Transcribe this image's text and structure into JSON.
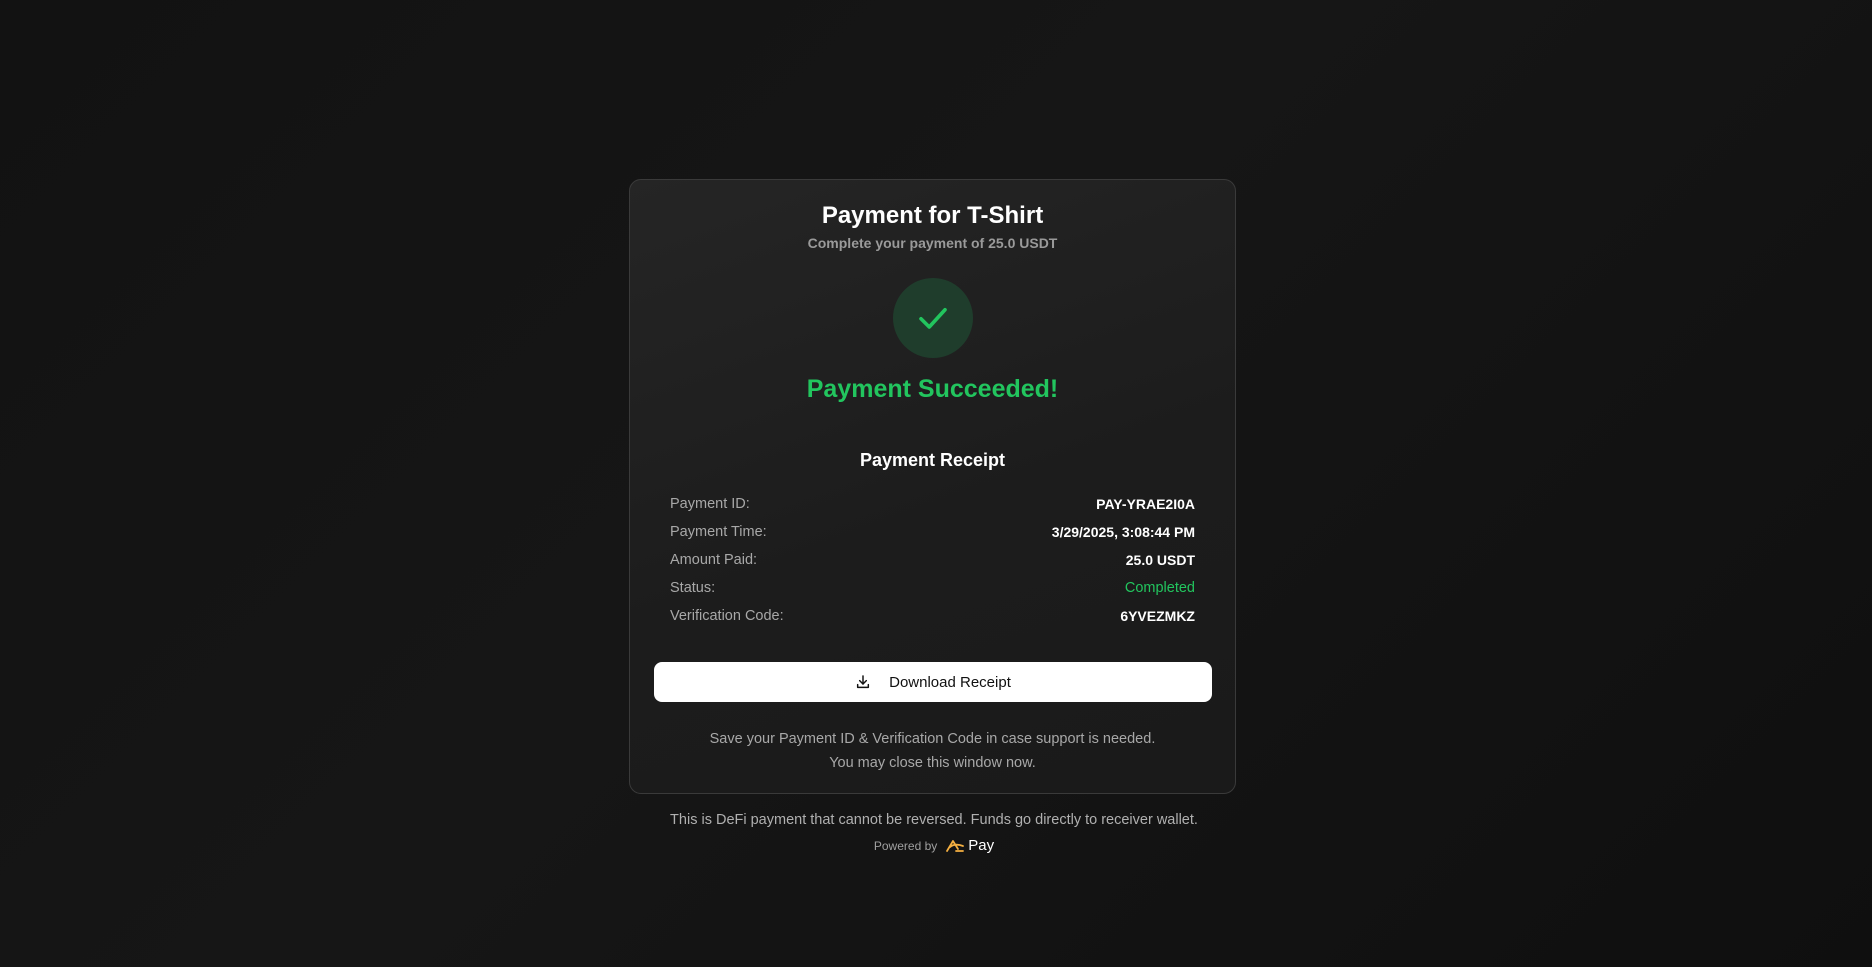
{
  "header": {
    "title": "Payment for T-Shirt",
    "subtitle": "Complete your payment of 25.0 USDT"
  },
  "status_icon": "check-icon",
  "success_message": "Payment Succeeded!",
  "receipt": {
    "title": "Payment Receipt",
    "rows": [
      {
        "label": "Payment ID:",
        "value": "PAY-YRAE2I0A"
      },
      {
        "label": "Payment Time:",
        "value": "3/29/2025, 3:08:44 PM"
      },
      {
        "label": "Amount Paid:",
        "value": "25.0 USDT"
      },
      {
        "label": "Status:",
        "value": "Completed"
      },
      {
        "label": "Verification Code:",
        "value": "6YVEZMKZ"
      }
    ]
  },
  "download_button": {
    "label": "Download Receipt",
    "icon": "download-icon"
  },
  "note": {
    "line1": "Save your Payment ID & Verification Code in case support is needed.",
    "line2": "You may close this window now."
  },
  "footer": {
    "disclaimer": "This is DeFi payment that cannot be reversed. Funds go directly to receiver wallet.",
    "powered_by": "Powered by",
    "brand_name": "Pay",
    "brand_icon": "brand-logo-icon"
  },
  "colors": {
    "success": "#22c55e",
    "background": "#141414",
    "card": "#202020",
    "brand_accent": "#f5b041"
  }
}
